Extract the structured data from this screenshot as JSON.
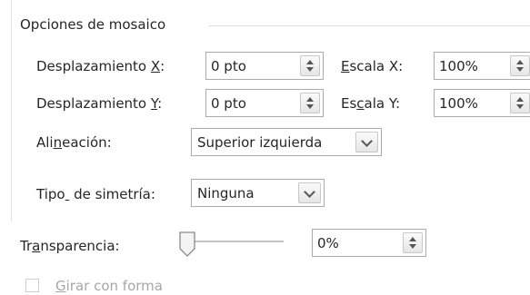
{
  "group": {
    "title": "Opciones de mosaico"
  },
  "offset_x": {
    "pre": "Desplazamiento ",
    "key": "X",
    "post": ":",
    "value": "0 pto"
  },
  "offset_y": {
    "pre": "Desplazamiento ",
    "key": "Y",
    "post": ":",
    "value": "0 pto"
  },
  "scale_x": {
    "pre": "",
    "key": "E",
    "post": "scala X:",
    "value": "100%"
  },
  "scale_y": {
    "pre": "Es",
    "key": "c",
    "post": "ala Y:",
    "value": "100%"
  },
  "alignment": {
    "pre": "Ali",
    "key": "n",
    "post": "eación:",
    "value": "Superior izquierda"
  },
  "mirror": {
    "pre": "Tipo",
    "key": "_",
    "post": " de simetría:",
    "value": "Ninguna"
  },
  "transparency": {
    "pre": "Tr",
    "key": "a",
    "post": "nsparencia:",
    "value": "0%",
    "level_percent": 0
  },
  "rotate": {
    "pre": "",
    "key": "G",
    "post": "irar con forma",
    "checked": false,
    "enabled": false
  },
  "icons": {
    "spin": "up-down-spinner-icon",
    "dropdown": "chevron-down-icon",
    "slider": "slider-thumb-icon"
  }
}
